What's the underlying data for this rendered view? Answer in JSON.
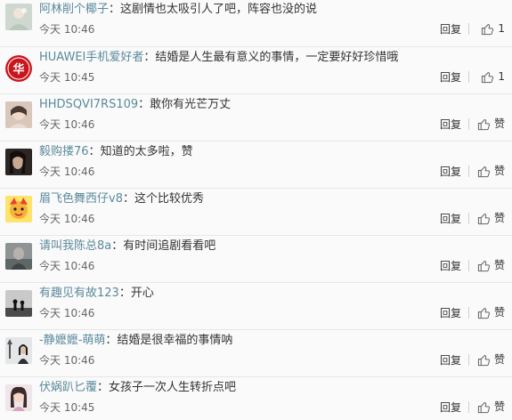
{
  "comments": [
    {
      "username": "阿林削个椰子",
      "text": "这剧情也太吸引人了吧，阵容也没的说",
      "time": "今天 10:46",
      "reply_label": "回复",
      "like_label": "1",
      "avatar_icon": "avatar-icon"
    },
    {
      "username": "HUAWEI手机爱好者",
      "text": "结婚是人生最有意义的事情，一定要好好珍惜哦",
      "time": "今天 10:45",
      "reply_label": "回复",
      "like_label": "1",
      "avatar_icon": "avatar-icon",
      "avatar_glyph": "华"
    },
    {
      "username": "HHDSQVI7RS109",
      "text": "敢你有光芒万丈",
      "time": "今天 10:46",
      "reply_label": "回复",
      "like_label": "赞",
      "avatar_icon": "avatar-icon"
    },
    {
      "username": "毅购搂76",
      "text": "知道的太多啦，赞",
      "time": "今天 10:46",
      "reply_label": "回复",
      "like_label": "赞",
      "avatar_icon": "avatar-icon"
    },
    {
      "username": "眉飞色舞西仔v8",
      "text": "这个比较优秀",
      "time": "今天 10:46",
      "reply_label": "回复",
      "like_label": "赞",
      "avatar_icon": "avatar-icon"
    },
    {
      "username": "请叫我陈总8a",
      "text": "有时间追剧看看吧",
      "time": "今天 10:46",
      "reply_label": "回复",
      "like_label": "赞",
      "avatar_icon": "avatar-icon"
    },
    {
      "username": "有趣见有故123",
      "text": "开心",
      "time": "今天 10:46",
      "reply_label": "回复",
      "like_label": "赞",
      "avatar_icon": "avatar-icon"
    },
    {
      "username": "-静嬷嬷-萌萌",
      "text": "结婚是很幸福的事情呐",
      "time": "今天 10:46",
      "reply_label": "回复",
      "like_label": "赞",
      "avatar_icon": "avatar-icon"
    },
    {
      "username": "伏娲趴匕覆",
      "text": "女孩子一次人生转折点吧",
      "time": "今天 10:45",
      "reply_label": "回复",
      "like_label": "赞",
      "avatar_icon": "avatar-icon"
    }
  ],
  "separator": "：",
  "colors": {
    "username": "#5a8a9c",
    "text": "#333333",
    "timestamp": "#666666",
    "divider": "#e6e6e6",
    "background": "#fafafa"
  }
}
